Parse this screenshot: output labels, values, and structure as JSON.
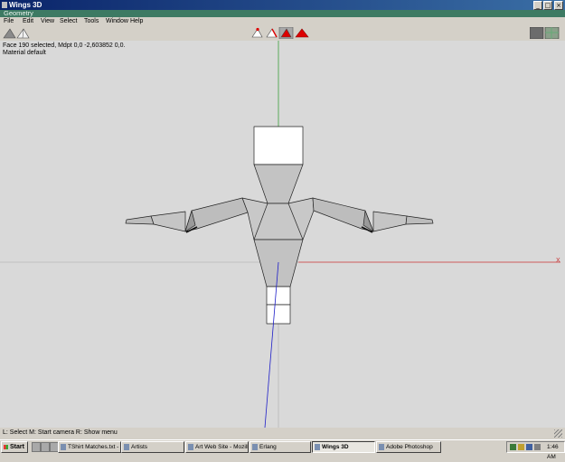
{
  "window": {
    "title": "Wings 3D",
    "buttons": {
      "minimize": "_",
      "maximize": "□",
      "close": "×"
    }
  },
  "geometry_bar": {
    "label": "Geometry"
  },
  "menubar": {
    "items": [
      "File",
      "Edit",
      "View",
      "Select",
      "Tools",
      "Window",
      "Help"
    ]
  },
  "toolbar": {
    "left_icons": [
      "view-solid-icon",
      "view-wireframe-icon"
    ],
    "mode_icons": [
      "vertex-mode-icon",
      "edge-mode-icon",
      "face-mode-icon",
      "body-mode-icon"
    ],
    "right_icons": [
      "toggle-display-icon",
      "toggle-grid-icon"
    ]
  },
  "viewport": {
    "info_line1": "Face 190 selected, Mdpt 0,0 -2,603852 0,0.",
    "info_line2": "Material default",
    "axis_x_label": "X",
    "colors": {
      "background": "#d9d9d9",
      "mesh": "#c8c8c8",
      "selected_face": "#ffffff",
      "x_axis": "#c83232",
      "y_axis": "#3ca03c",
      "z_axis": "#1e1ec8"
    }
  },
  "statusbar": {
    "text": "L: Select   M: Start camera   R: Show menu"
  },
  "taskbar": {
    "start_label": "Start",
    "tasks": [
      {
        "label": "TShirt Matches.txt - ...",
        "active": false
      },
      {
        "label": "Artists",
        "active": false
      },
      {
        "label": "Art Web Site - Mozilla",
        "active": false
      },
      {
        "label": "Erlang",
        "active": false
      },
      {
        "label": "Wings 3D",
        "active": true
      },
      {
        "label": "Adobe Photoshop",
        "active": false
      }
    ],
    "clock": "1:46 AM"
  }
}
